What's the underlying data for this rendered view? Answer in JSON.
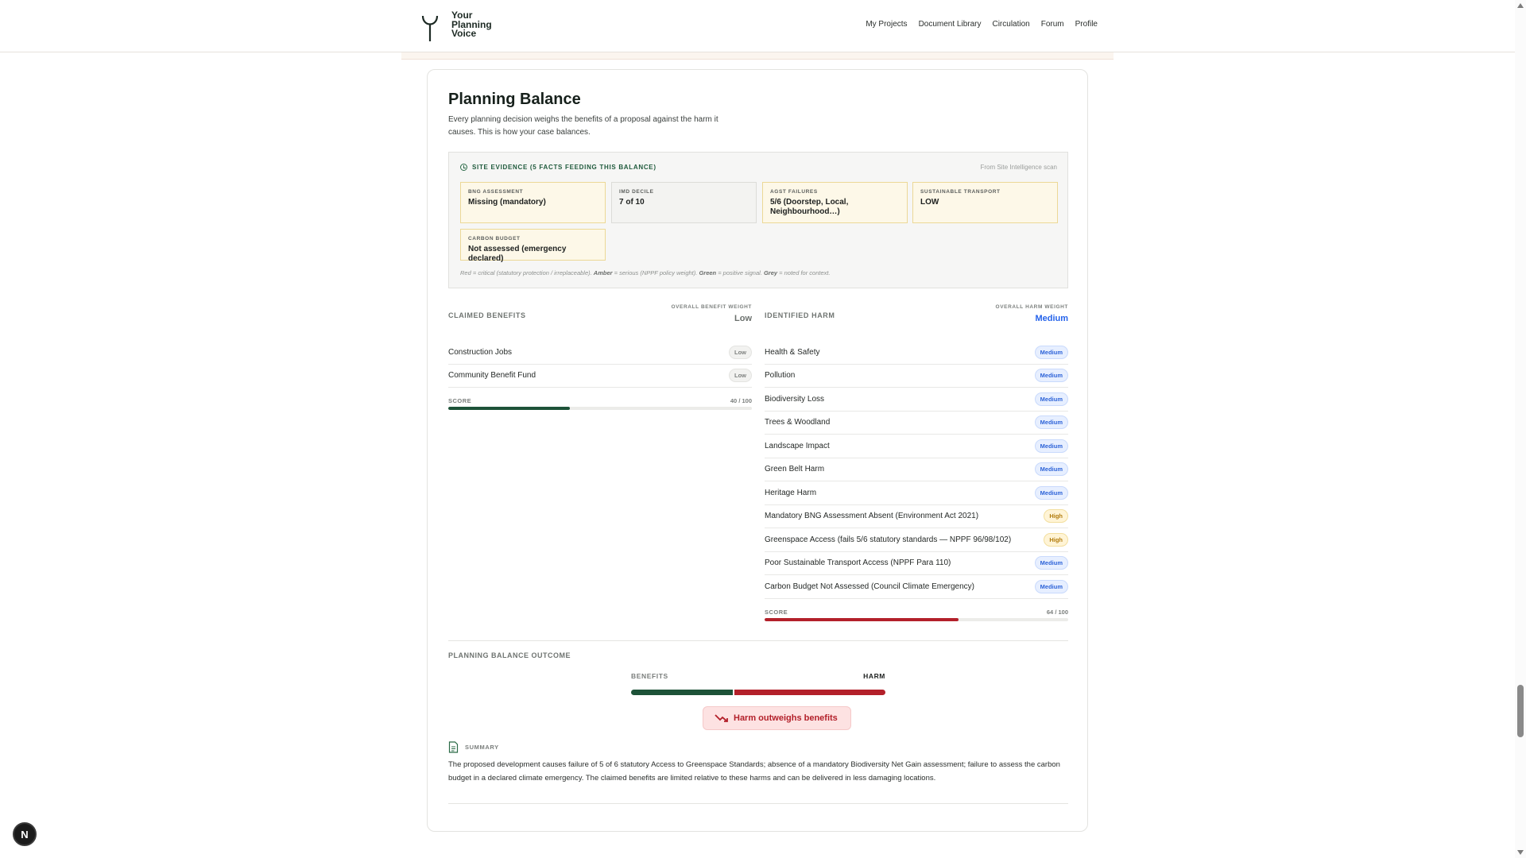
{
  "brand": {
    "line1": "Your",
    "line2": "Planning",
    "line3": "Voice"
  },
  "nav": [
    "My Projects",
    "Document Library",
    "Circulation",
    "Forum",
    "Profile"
  ],
  "card": {
    "title": "Planning Balance",
    "lede": "Every planning decision weighs the benefits of a proposal against the harm it causes. This is how your case balances."
  },
  "evidence": {
    "title": "Site Evidence (5 facts feeding this balance)",
    "source": "From Site Intelligence scan",
    "facts": [
      {
        "label": "BNG Assessment",
        "value": "Missing (mandatory)",
        "tone": "amber"
      },
      {
        "label": "IMD Decile",
        "value": "7 of 10",
        "tone": "grey"
      },
      {
        "label": "AGST Failures",
        "value": "5/6 (Doorstep, Local, Neighbourhood…)",
        "tone": "amber"
      },
      {
        "label": "Sustainable Transport",
        "value": "LOW",
        "tone": "amber"
      },
      {
        "label": "Carbon Budget",
        "value": "Not assessed (emergency declared)",
        "tone": "amber"
      }
    ],
    "legend": {
      "red": "Red",
      "red_text": " = critical (statutory protection / irreplaceable). ",
      "amber": "Amber",
      "amber_text": " = serious (NPPF policy weight). ",
      "green": "Green",
      "green_text": " = positive signal. ",
      "grey": "Grey",
      "grey_text": " = noted for context."
    }
  },
  "benefits": {
    "title": "Claimed Benefits",
    "weight_label": "Overall Benefit Weight",
    "weight_value": "Low",
    "items": [
      {
        "name": "Construction Jobs",
        "level": "Low"
      },
      {
        "name": "Community Benefit Fund",
        "level": "Low"
      }
    ],
    "score_label": "Score",
    "score_text": "40 / 100",
    "score": 40
  },
  "harm": {
    "title": "Identified Harm",
    "weight_label": "Overall Harm Weight",
    "weight_value": "Medium",
    "items": [
      {
        "name": "Health & Safety",
        "level": "Medium"
      },
      {
        "name": "Pollution",
        "level": "Medium"
      },
      {
        "name": "Biodiversity Loss",
        "level": "Medium"
      },
      {
        "name": "Trees & Woodland",
        "level": "Medium"
      },
      {
        "name": "Landscape Impact",
        "level": "Medium"
      },
      {
        "name": "Green Belt Harm",
        "level": "Medium"
      },
      {
        "name": "Heritage Harm",
        "level": "Medium"
      },
      {
        "name": "Mandatory BNG Assessment Absent (Environment Act 2021)",
        "level": "High"
      },
      {
        "name": "Greenspace Access (fails 5/6 statutory standards — NPPF 96/98/102)",
        "level": "High"
      },
      {
        "name": "Poor Sustainable Transport Access (NPPF Para 110)",
        "level": "Medium"
      },
      {
        "name": "Carbon Budget Not Assessed (Council Climate Emergency)",
        "level": "Medium"
      }
    ],
    "score_label": "Score",
    "score_text": "64 / 100",
    "score": 64
  },
  "outcome": {
    "title": "Planning Balance Outcome",
    "benefits_label": "Benefits",
    "harm_label": "Harm",
    "benefits_share": 40,
    "harm_share": 60,
    "verdict": "Harm outweighs benefits",
    "summary_label": "Summary",
    "summary": "The proposed development causes failure of 5 of 6 statutory Access to Greenspace Standards; absence of a mandatory Biodiversity Net Gain assessment; failure to assess the carbon budget in a declared climate emergency. The claimed benefits are limited relative to these harms and can be delivered in less damaging locations."
  },
  "colors": {
    "benefit": "#1d5238",
    "harm": "#b3202a",
    "accent_blue": "#2563eb"
  },
  "badge": "N"
}
